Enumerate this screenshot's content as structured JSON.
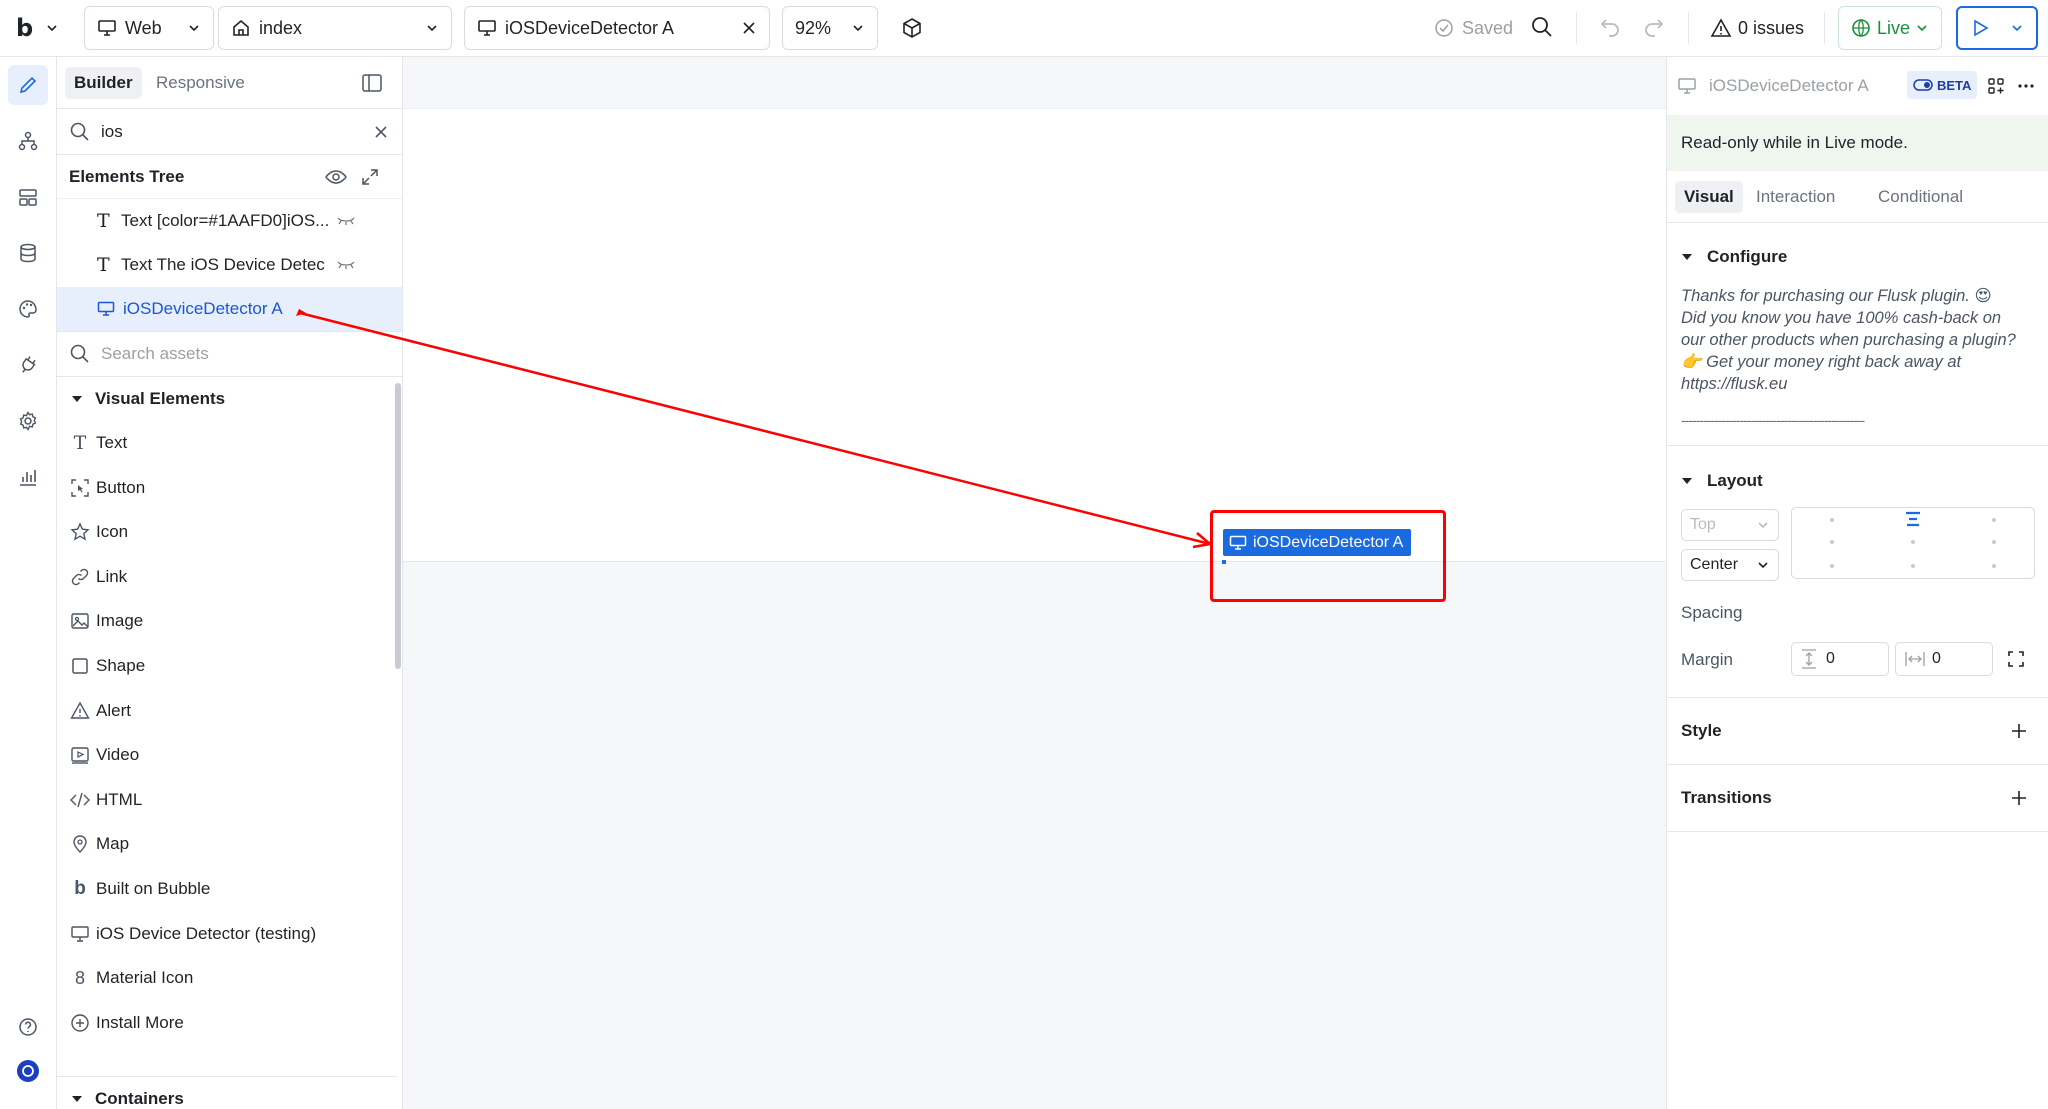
{
  "topbar": {
    "logo": "b",
    "platform": "Web",
    "page": "index",
    "element_tab": "iOSDeviceDetector A",
    "zoom": "92%",
    "saved": "Saved",
    "issues": "0 issues",
    "live": "Live"
  },
  "left_panel": {
    "tabs": [
      "Builder",
      "Responsive"
    ],
    "search_value": "ios",
    "tree_title": "Elements Tree",
    "tree_items": [
      "Text [color=#1AAFD0]iOS...",
      "Text The iOS Device Detec",
      "iOSDeviceDetector A"
    ],
    "assets_placeholder": "Search assets",
    "visual_section": "Visual Elements",
    "visual_items": [
      {
        "label": "Text",
        "icon": "text-icon"
      },
      {
        "label": "Button",
        "icon": "button-icon"
      },
      {
        "label": "Icon",
        "icon": "star-icon"
      },
      {
        "label": "Link",
        "icon": "link-icon"
      },
      {
        "label": "Image",
        "icon": "image-icon"
      },
      {
        "label": "Shape",
        "icon": "square-icon"
      },
      {
        "label": "Alert",
        "icon": "alert-icon"
      },
      {
        "label": "Video",
        "icon": "video-icon"
      },
      {
        "label": "HTML",
        "icon": "code-icon"
      },
      {
        "label": "Map",
        "icon": "map-pin-icon"
      },
      {
        "label": "Built on Bubble",
        "icon": "bubble-logo-icon"
      },
      {
        "label": "iOS Device Detector (testing)",
        "icon": "monitor-icon"
      },
      {
        "label": "Material Icon",
        "icon": "material-icon"
      },
      {
        "label": "Install More",
        "icon": "plus-circle-icon"
      }
    ],
    "containers_section": "Containers"
  },
  "canvas": {
    "element_label": "iOSDeviceDetector A"
  },
  "right_panel": {
    "title": "iOSDeviceDetector A",
    "beta": "BETA",
    "readonly_notice": "Read-only while in Live mode.",
    "tabs": [
      "Visual",
      "Interaction",
      "Conditional"
    ],
    "configure_title": "Configure",
    "configure_desc": "Thanks for purchasing our Flusk plugin. 😍 Did you know you have 100% cash-back on our other products when purchasing a plugin? 👉 Get your money right back away at https://flusk.eu",
    "dashes": "--------------------------------------------------",
    "layout_title": "Layout",
    "vertical_align": "Top",
    "horizontal_align": "Center",
    "spacing_label": "Spacing",
    "margin_label": "Margin",
    "margin_vertical": "0",
    "margin_horizontal": "0",
    "style_title": "Style",
    "transitions_title": "Transitions"
  },
  "colors": {
    "accent": "#1b6be0",
    "annotation": "#ff0000",
    "live_green": "#1a8f3c"
  }
}
